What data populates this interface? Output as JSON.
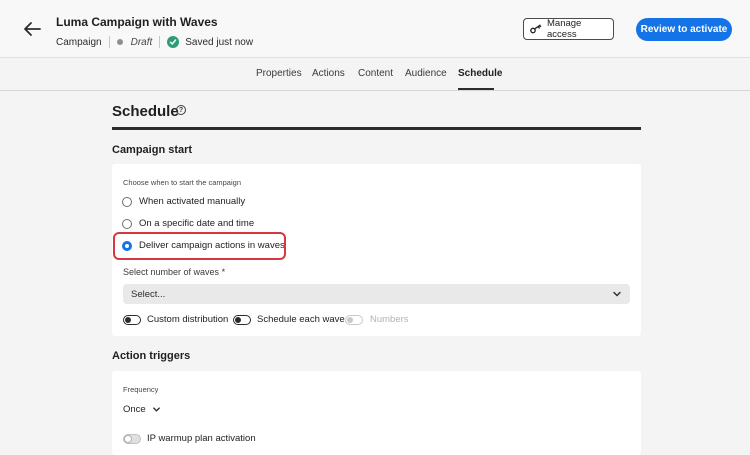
{
  "header": {
    "title": "Luma Campaign with Waves",
    "type": "Campaign",
    "status": "Draft",
    "saved": "Saved just now",
    "manage_access": "Manage access",
    "review": "Review to activate"
  },
  "tabs": [
    "Properties",
    "Actions",
    "Content",
    "Audience",
    "Schedule"
  ],
  "active_tab": "Schedule",
  "page_title": "Schedule",
  "campaign_start": {
    "heading": "Campaign start",
    "prompt": "Choose when to start the campaign",
    "options": [
      "When activated manually",
      "On a specific date and time",
      "Deliver campaign actions in waves"
    ],
    "selected": "Deliver campaign actions in waves",
    "waves_label": "Select number of waves",
    "waves_placeholder": "Select...",
    "toggles": [
      "Custom distribution",
      "Schedule each wave",
      "Numbers"
    ]
  },
  "action_triggers": {
    "heading": "Action triggers",
    "frequency_label": "Frequency",
    "frequency_value": "Once",
    "ip_warmup": "IP warmup plan activation"
  },
  "colors": {
    "accent": "#1473e6",
    "highlight": "#d7373f",
    "success": "#2d9d78"
  }
}
